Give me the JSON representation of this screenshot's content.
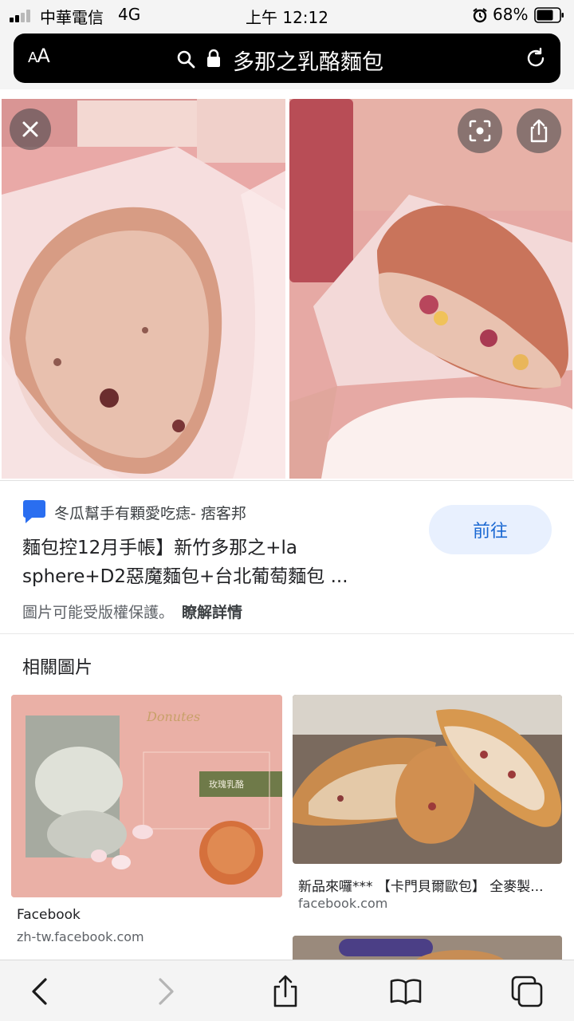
{
  "status_bar": {
    "carrier": "中華電信",
    "network": "4G",
    "time": "上午 12:12",
    "battery": "68%"
  },
  "browser": {
    "text_size_label_small": "A",
    "text_size_label_large": "A",
    "url_text": "多那之乳酪麵包"
  },
  "result": {
    "site_name": "冬瓜幫手有顆愛吃痣- 痞客邦",
    "title": "麵包控12月手帳】新竹多那之+la sphere+D2惡魔麵包+台北葡萄麵包 ...",
    "visit_label": "前往",
    "copyright_text": "圖片可能受版權保護。",
    "learn_more": "瞭解詳情"
  },
  "related": {
    "heading": "相關圖片",
    "cards": [
      {
        "label": "Facebook",
        "domain": "zh-tw.facebook.com",
        "thumb_title": "Donutes",
        "thumb_tag": "玫瑰乳酪"
      },
      {
        "label": "新品來囉*** 【卡門貝爾歐包】 全麥製...",
        "domain": "facebook.com"
      }
    ]
  },
  "icons": [
    "search-icon",
    "lock-icon",
    "reload-icon",
    "close-icon",
    "lens-icon",
    "share-icon",
    "back-icon",
    "forward-icon",
    "bookmarks-icon",
    "tabs-icon"
  ],
  "colors": {
    "accent": "#1967d2",
    "visit_button_bg": "#e8f0fe",
    "address_bar": "#000000",
    "chrome": "#f4f4f4"
  }
}
